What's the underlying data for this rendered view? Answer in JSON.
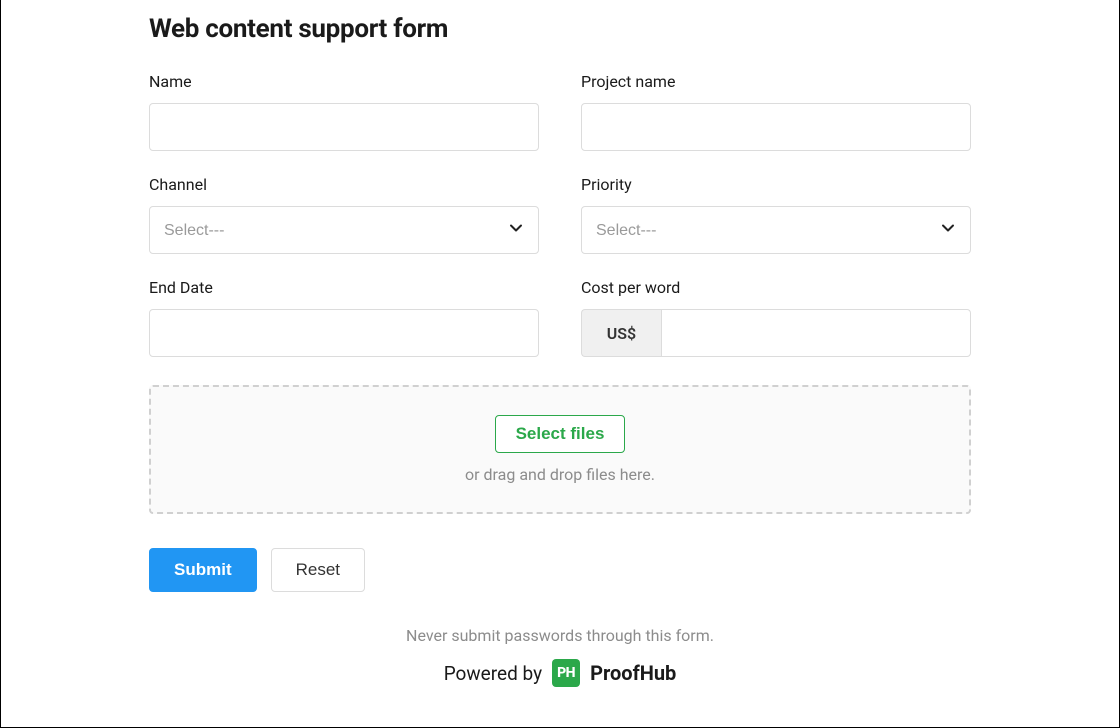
{
  "form": {
    "title": "Web content support form",
    "fields": {
      "name": {
        "label": "Name",
        "value": ""
      },
      "project_name": {
        "label": "Project name",
        "value": ""
      },
      "channel": {
        "label": "Channel",
        "placeholder": "Select---"
      },
      "priority": {
        "label": "Priority",
        "placeholder": "Select---"
      },
      "end_date": {
        "label": "End Date",
        "value": ""
      },
      "cost_per_word": {
        "label": "Cost per word",
        "prefix": "US$",
        "value": ""
      }
    },
    "upload": {
      "button_label": "Select files",
      "hint": "or drag and drop files here."
    },
    "actions": {
      "submit": "Submit",
      "reset": "Reset"
    }
  },
  "footer": {
    "disclaimer": "Never submit passwords through this form.",
    "powered_by_prefix": "Powered by",
    "logo_text": "PH",
    "brand": "ProofHub"
  }
}
